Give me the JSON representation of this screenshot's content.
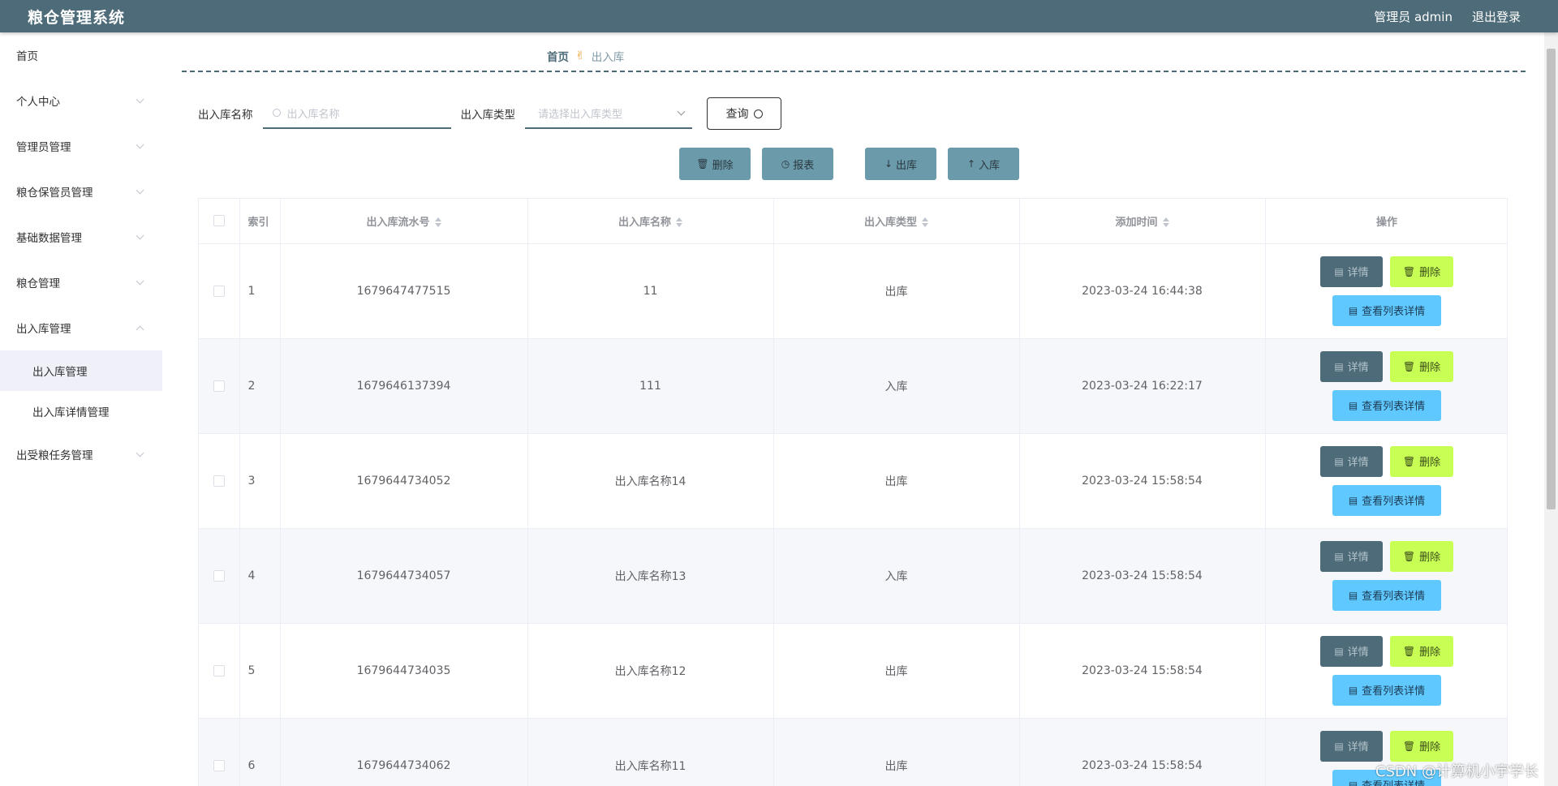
{
  "header": {
    "title": "粮仓管理系统",
    "user_label": "管理员 admin",
    "logout_label": "退出登录"
  },
  "sidebar": {
    "items": [
      {
        "label": "首页"
      },
      {
        "label": "个人中心"
      },
      {
        "label": "管理员管理"
      },
      {
        "label": "粮仓保管员管理"
      },
      {
        "label": "基础数据管理"
      },
      {
        "label": "粮仓管理"
      },
      {
        "label": "出入库管理"
      },
      {
        "label": "出受粮任务管理"
      }
    ],
    "subitems": [
      {
        "label": "出入库管理"
      },
      {
        "label": "出入库详情管理"
      }
    ]
  },
  "breadcrumb": {
    "home": "首页",
    "current": "出入库"
  },
  "search": {
    "name_label": "出入库名称",
    "name_placeholder": "出入库名称",
    "type_label": "出入库类型",
    "type_placeholder": "请选择出入库类型",
    "query_label": "查询"
  },
  "actions": {
    "delete": "删除",
    "report": "报表",
    "out": "出库",
    "in": "入库"
  },
  "table": {
    "columns": [
      "索引",
      "出入库流水号",
      "出入库名称",
      "出入库类型",
      "添加时间",
      "操作"
    ],
    "rows": [
      {
        "index": "1",
        "serial": "1679647477515",
        "name": "11",
        "type": "出库",
        "time": "2023-03-24 16:44:38"
      },
      {
        "index": "2",
        "serial": "1679646137394",
        "name": "111",
        "type": "入库",
        "time": "2023-03-24 16:22:17"
      },
      {
        "index": "3",
        "serial": "1679644734052",
        "name": "出入库名称14",
        "type": "出库",
        "time": "2023-03-24 15:58:54"
      },
      {
        "index": "4",
        "serial": "1679644734057",
        "name": "出入库名称13",
        "type": "入库",
        "time": "2023-03-24 15:58:54"
      },
      {
        "index": "5",
        "serial": "1679644734035",
        "name": "出入库名称12",
        "type": "出库",
        "time": "2023-03-24 15:58:54"
      },
      {
        "index": "6",
        "serial": "1679644734062",
        "name": "出入库名称11",
        "type": "出库",
        "time": "2023-03-24 15:58:54"
      }
    ],
    "op_detail": "详情",
    "op_delete": "删除",
    "op_list": "查看列表详情"
  },
  "watermark": "CSDN @计算机小宇学长",
  "colors": {
    "header_bg": "#4d6b78",
    "action_btn": "#6b9aab",
    "detail_btn": "#4d6b78",
    "delete_btn": "#c7ff55",
    "list_btn": "#5ec8ff"
  }
}
